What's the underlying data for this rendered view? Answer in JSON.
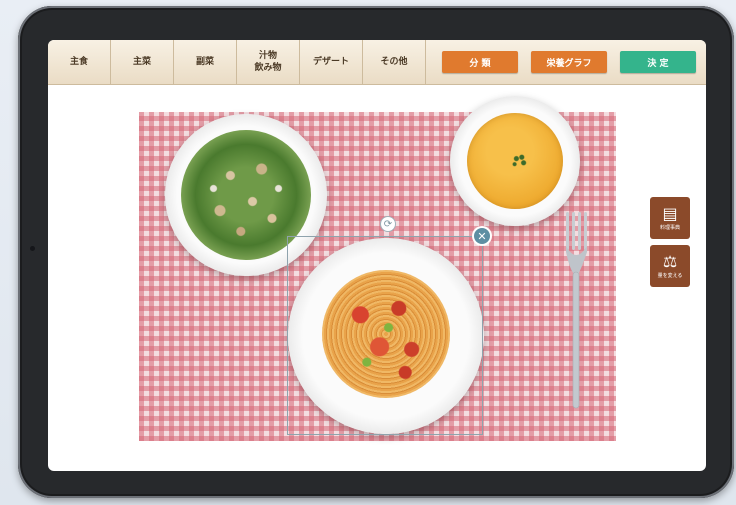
{
  "toolbar": {
    "tabs": [
      {
        "label": "主食"
      },
      {
        "label": "主菜"
      },
      {
        "label": "副菜"
      },
      {
        "label_line1": "汁物",
        "label_line2": "飲み物"
      },
      {
        "label": "デザート"
      },
      {
        "label": "その他"
      }
    ],
    "actions": [
      {
        "label": "分 類",
        "color": "#e07a2e"
      },
      {
        "label": "栄養グラフ",
        "color": "#e07a2e"
      },
      {
        "label": "決 定",
        "color": "#34b48c"
      }
    ]
  },
  "side_buttons": [
    {
      "label": "料理事典",
      "icon": "open-book-icon"
    },
    {
      "label": "量を変える",
      "icon": "scale-icon"
    }
  ],
  "canvas": {
    "placemat": "pink gingham",
    "items": [
      "salad",
      "corn-soup",
      "napolitan-pasta",
      "fork"
    ],
    "selected": "napolitan-pasta"
  },
  "colors": {
    "accent_orange": "#e07a2e",
    "accent_green": "#34b48c",
    "side_brown": "#8b4a2a",
    "toolbar_bg": "#f3e8d6"
  }
}
